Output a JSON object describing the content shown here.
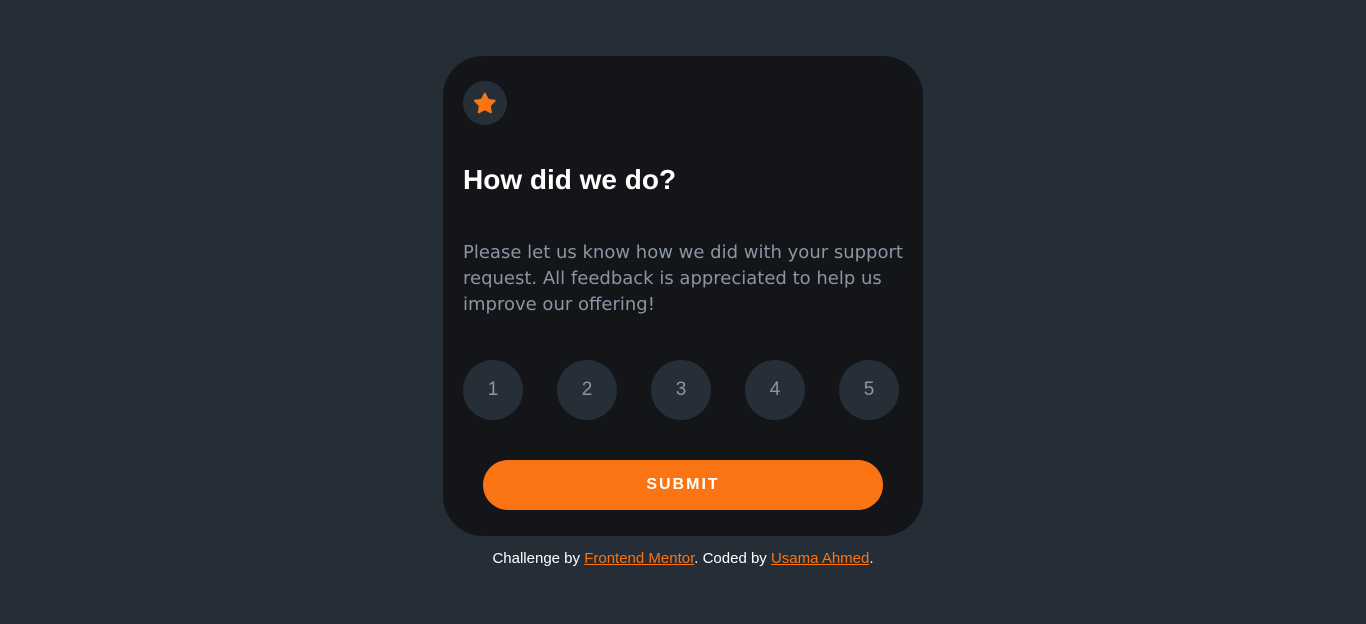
{
  "card": {
    "icon": "star-icon",
    "title": "How did we do?",
    "description": "Please let us know how we did with your support request. All feedback is appreciated to help us improve our offering!",
    "ratings": [
      "1",
      "2",
      "3",
      "4",
      "5"
    ],
    "submit_label": "SUBMIT"
  },
  "attribution": {
    "prefix": "Challenge by ",
    "link1": "Frontend Mentor",
    "middle": ". Coded by ",
    "link2": "Usama Ahmed",
    "suffix": "."
  },
  "colors": {
    "background": "#252d37",
    "card": "#131518",
    "accent": "#fb7413",
    "muted_text": "#8b95a5",
    "circle": "#262e38"
  }
}
